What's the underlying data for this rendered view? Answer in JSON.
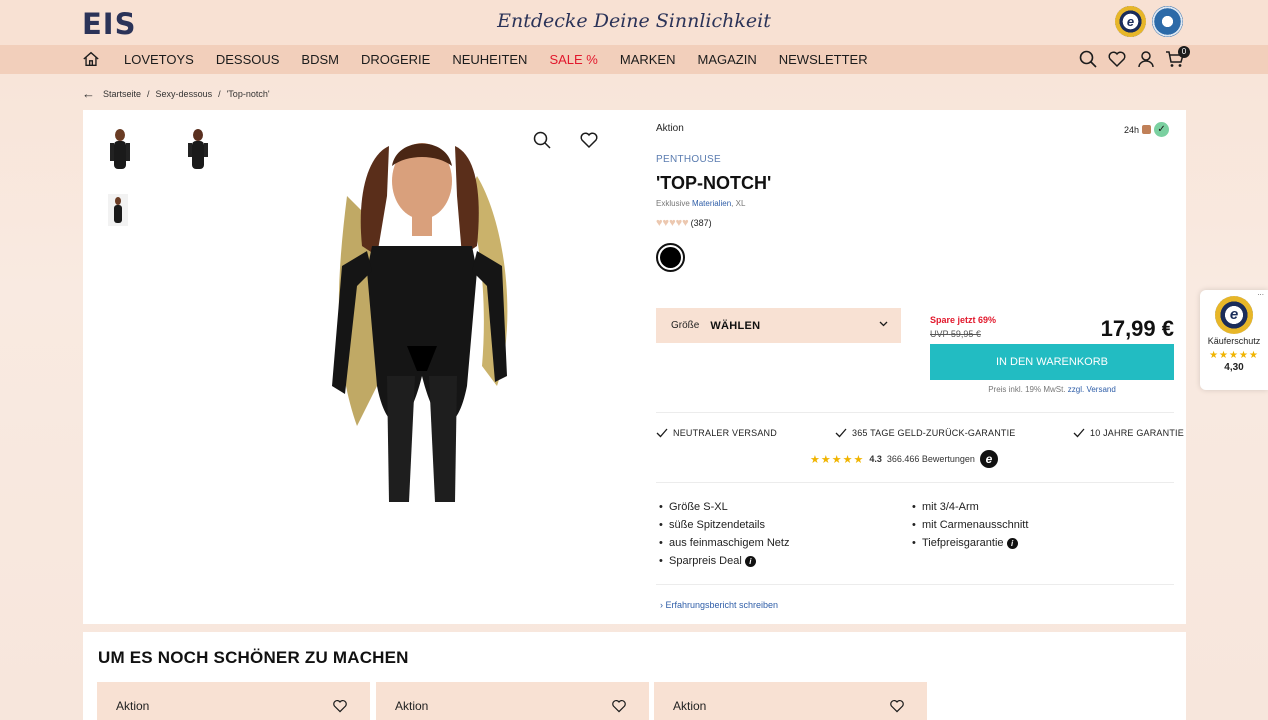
{
  "header": {
    "logo": "EIS",
    "tagline": "Entdecke Deine Sinnlichkeit",
    "seal1_text": "e",
    "seal2_text": "",
    "cart_count": "0"
  },
  "nav": {
    "items": [
      "LOVETOYS",
      "DESSOUS",
      "BDSM",
      "DROGERIE",
      "NEUHEITEN",
      "SALE %",
      "MARKEN",
      "MAGAZIN",
      "NEWSLETTER"
    ]
  },
  "breadcrumb": {
    "back": "←",
    "items": [
      "Startseite",
      "Sexy-dessous",
      "'Top-notch'"
    ],
    "separator": "/"
  },
  "product": {
    "badge": "Aktion",
    "delivery": "24h",
    "delivery_check": "✓",
    "brand": "PENTHOUSE",
    "title": "'TOP-NOTCH'",
    "sub_prefix": "Exklusive",
    "sub_link": "Materialien",
    "sub_suffix": ", XL",
    "rating_icons": "♥♥♥♥♥",
    "rating_count": "(387)",
    "size_label": "Größe",
    "size_value": "WÄHLEN",
    "save_text": "Spare jetzt 69%",
    "uvp_label": "UVP",
    "uvp_price": "59,95 €",
    "price": "17,99 €",
    "cart_button": "IN DEN WARENKORB",
    "price_note": "Preis inkl. 19% MwSt.",
    "price_note_link": "zzgl. Versand",
    "usp": [
      "NEUTRALER VERSAND",
      "365 TAGE GELD-ZURÜCK-GARANTIE",
      "10 JAHRE GARANTIE"
    ],
    "ts_stars": "★★★★★",
    "ts_score": "4.3",
    "ts_count": "366.466 Bewertungen",
    "ts_logo": "e",
    "features_left": [
      "Größe S-XL",
      "süße Spitzendetails",
      "aus feinmaschigem Netz",
      "Sparpreis Deal"
    ],
    "features_right": [
      "mit 3/4-Arm",
      "mit Carmenausschnitt",
      "Tiefpreisgarantie"
    ],
    "info_icon": "i",
    "review_link": "Erfahrungsbericht schreiben"
  },
  "trusted_widget": {
    "badge": "e",
    "label": "Käuferschutz",
    "stars": "★★★★★",
    "score": "4,30",
    "dots": "..."
  },
  "lower": {
    "title": "UM ES NOCH SCHÖNER ZU MACHEN",
    "cards": [
      {
        "tag": "Aktion"
      },
      {
        "tag": "Aktion"
      },
      {
        "tag": "Aktion"
      }
    ]
  },
  "colors": {
    "accent_cart": "#22bcc2",
    "sale": "#e2182c",
    "link": "#2f5ea8",
    "nav_bg": "#f2cfbb",
    "header_bg": "#f8e1d3"
  }
}
